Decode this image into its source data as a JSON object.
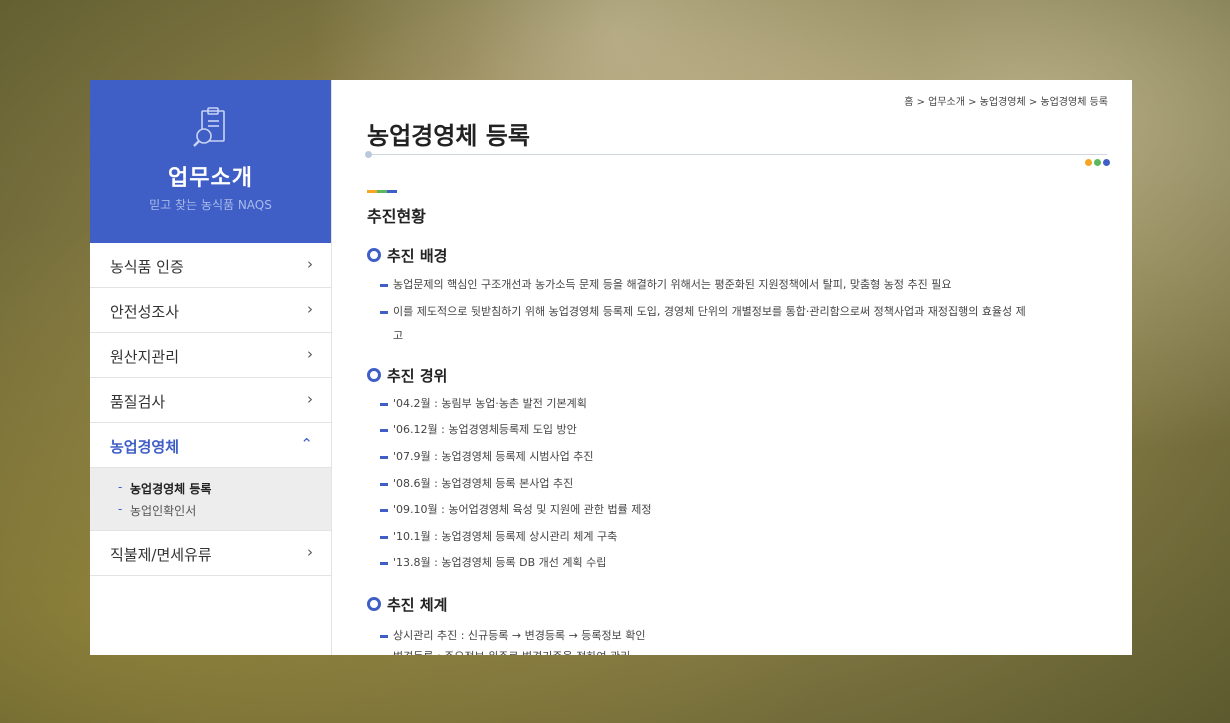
{
  "colors": {
    "primary": "#3f5fc6",
    "dot_orange": "#f5a623",
    "dot_green": "#5cb85c",
    "dot_blue": "#3f5fc6"
  },
  "sidebar": {
    "icon": "clipboard-search-icon",
    "title": "업무소개",
    "subtitle": "믿고 찾는 농식품 NAQS",
    "menu": [
      {
        "label": "농식품 인증",
        "arrow": "›"
      },
      {
        "label": "안전성조사",
        "arrow": "›"
      },
      {
        "label": "원산지관리",
        "arrow": "›"
      },
      {
        "label": "품질검사",
        "arrow": "›"
      },
      {
        "label": "농업경영체",
        "arrow": "⌃"
      },
      {
        "label": "직불제/면세유류",
        "arrow": "›"
      }
    ],
    "submenu": [
      {
        "label": "농업경영체 등록"
      },
      {
        "label": "농업인확인서"
      }
    ]
  },
  "breadcrumb": "홈 > 업무소개 > 농업경영체 > 농업경영체 등록",
  "page_title": "농업경영체 등록",
  "section_title": "추진현황",
  "subsections": [
    {
      "heading": "추진 배경",
      "items": [
        "농업문제의 핵심인 구조개선과 농가소득 문제 등을 해결하기 위해서는 평준화된 지원정책에서 탈피, 맞춤형 농정 추진 필요",
        "이를 제도적으로 뒷받침하기 위해 농업경영체 등록제 도입, 경영체 단위의 개별정보를 통합·관리함으로써 정책사업과 재정집행의 효율성 제",
        "고"
      ]
    },
    {
      "heading": "추진 경위",
      "items": [
        "'04.2월 : 농림부 농업·농촌 발전 기본계획",
        "'06.12월 : 농업경영체등록제 도입 방안",
        "'07.9월 : 농업경영체 등록제 시범사업 추진",
        "'08.6월 : 농업경영체 등록 본사업 추진",
        "'09.10월 : 농어업경영체 육성 및 지원에 관한 법률 제정",
        "'10.1월 : 농업경영체 등록제 상시관리 체계 구축",
        "'13.8월 : 농업경영체 등록 DB 개선 계획 수립"
      ]
    },
    {
      "heading": "추진 체계",
      "items": [
        "상시관리 추진 : 신규등록 → 변경등록 → 등록정보 확인",
        "변경등록 : 주요정보 위주로 변경기준을 정하여 관리"
      ]
    }
  ]
}
